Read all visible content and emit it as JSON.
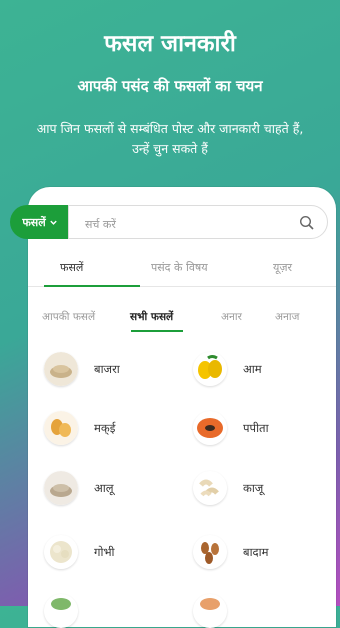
{
  "hero": {
    "title": "फसल जानकारी",
    "subtitle": "आपकी पसंद की फसलों का चयन",
    "description": "आप जिन फसलों से सम्बंधित पोस्ट और जानकारी चाहते हैं, उन्हें चुन सकते हैं"
  },
  "search": {
    "filter_label": "फसलें",
    "placeholder": "सर्च करें"
  },
  "tabs": [
    "फसलें",
    "पसंद के विषय",
    "यूज़र"
  ],
  "subtabs": [
    "आपकी फसलें",
    "सभी फसलें",
    "अनार",
    "अनाज"
  ],
  "crops": [
    {
      "name": "बाजरा",
      "icon": "millet-icon"
    },
    {
      "name": "आम",
      "icon": "mango-icon"
    },
    {
      "name": "मक्ई",
      "icon": "maize-icon"
    },
    {
      "name": "पपीता",
      "icon": "papaya-icon"
    },
    {
      "name": "आलू",
      "icon": "potato-icon"
    },
    {
      "name": "काजू",
      "icon": "cashew-icon"
    },
    {
      "name": "गोभी",
      "icon": "cauliflower-icon"
    },
    {
      "name": "बादाम",
      "icon": "almond-icon"
    }
  ],
  "colors": {
    "accent": "#1c9e3a",
    "gradient_start": "#3db394",
    "gradient_end": "#b34fbf"
  }
}
